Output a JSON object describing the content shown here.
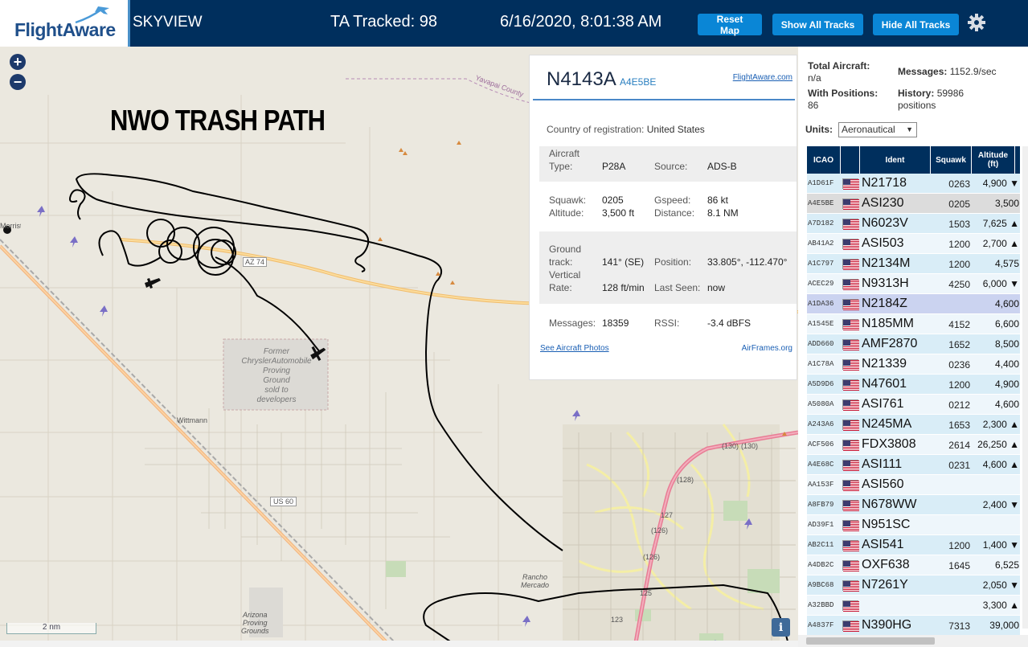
{
  "header": {
    "logo": "FlightAware",
    "app_title": "SKYVIEW",
    "ta_tracked": "TA Tracked: 98",
    "timestamp": "6/16/2020, 8:01:38 AM",
    "buttons": {
      "reset": "Reset Map",
      "show_all": "Show All Tracks",
      "hide_all": "Hide All Tracks"
    },
    "settings_icon": "gear-icon"
  },
  "map": {
    "zoom_in": "+",
    "zoom_out": "−",
    "annotation": "NWO TRASH PATH",
    "scale": "2 nm",
    "info": "i",
    "labels": {
      "former_site": [
        "Former",
        "ChryslerAutomobile",
        "Proving",
        "Ground",
        "sold to",
        "developers"
      ],
      "wittmann": "Wittmann",
      "us60": "US 60",
      "az74": "AZ 74",
      "rancho": [
        "Rancho",
        "Mercado"
      ],
      "arizona_pg": [
        "Arizona",
        "Proving",
        "Grounds"
      ],
      "town": "Morristown",
      "yavapai": "Yavapai County",
      "r127": "127",
      "r126a": "(126)",
      "r126b": "(126)",
      "r125": "125",
      "r123": "123",
      "r128": "(128)",
      "r130": "(130)",
      "r1301": "(130)"
    },
    "colors": {
      "track": "#000000",
      "road_primary": "#f6c27a",
      "road_major": "#e77f93",
      "railway": "#999999"
    }
  },
  "detail": {
    "callsign": "N4143A",
    "hex": "A4E5BE",
    "fa_link": "FlightAware.com",
    "country_label": "Country of registration:",
    "country": "United States",
    "aircraft_type_label": [
      "Aircraft",
      "Type:"
    ],
    "aircraft_type": "P28A",
    "source_label": "Source:",
    "source": "ADS-B",
    "squawk_label": "Squawk:",
    "squawk": "0205",
    "gspeed_label": "Gspeed:",
    "gspeed": "86 kt",
    "altitude_label": "Altitude:",
    "altitude": "3,500 ft",
    "distance_label": "Distance:",
    "distance": "8.1 NM",
    "track_label": [
      "Ground",
      "track:"
    ],
    "track": "141° (SE)",
    "position_label": "Position:",
    "position": "33.805°, -112.470°",
    "vrate_label": [
      "Vertical",
      "Rate:"
    ],
    "vrate": "128 ft/min",
    "last_seen_label": "Last Seen:",
    "last_seen": "now",
    "messages_label": "Messages:",
    "messages": "18359",
    "rssi_label": "RSSI:",
    "rssi": "-3.4 dBFS",
    "photos_link": "See Aircraft Photos",
    "airframes_link": "AirFrames.org"
  },
  "sidebar": {
    "total_aircraft_label": "Total Aircraft:",
    "total_aircraft": "n/a",
    "with_positions_label": "With Positions:",
    "with_positions": "86",
    "messages_label": "Messages:",
    "messages": "1152.9/sec",
    "history_label": "History:",
    "history": "59986",
    "history_unit": "positions",
    "units_label": "Units:",
    "units_value": "Aeronautical",
    "table": {
      "headers": {
        "icao": "ICAO",
        "ident": "Ident",
        "squawk": "Squawk",
        "altitude": [
          "Altitude",
          "(ft)"
        ]
      },
      "rows": [
        {
          "icao": "A1D61F",
          "ident": "N21718",
          "squawk": "0263",
          "alt": "4,900 ▼",
          "style": "alt"
        },
        {
          "icao": "A4E5BE",
          "ident": "ASI230",
          "squawk": "0205",
          "alt": "3,500",
          "style": "sel"
        },
        {
          "icao": "A7D182",
          "ident": "N6023V",
          "squawk": "1503",
          "alt": "7,625 ▲",
          "style": "alt"
        },
        {
          "icao": "AB41A2",
          "ident": "ASI503",
          "squawk": "1200",
          "alt": "2,700 ▲",
          "style": "plain"
        },
        {
          "icao": "A1C797",
          "ident": "N2134M",
          "squawk": "1200",
          "alt": "4,575",
          "style": "alt"
        },
        {
          "icao": "ACEC29",
          "ident": "N9313H",
          "squawk": "4250",
          "alt": "6,000 ▼",
          "style": "plain"
        },
        {
          "icao": "A1DA36",
          "ident": "N2184Z",
          "squawk": "",
          "alt": "4,600",
          "style": "hl"
        },
        {
          "icao": "A1545E",
          "ident": "N185MM",
          "squawk": "4152",
          "alt": "6,600",
          "style": "plain"
        },
        {
          "icao": "ADD660",
          "ident": "AMF2870",
          "squawk": "1652",
          "alt": "8,500",
          "style": "alt"
        },
        {
          "icao": "A1C78A",
          "ident": "N21339",
          "squawk": "0236",
          "alt": "4,400",
          "style": "plain"
        },
        {
          "icao": "A5D9D6",
          "ident": "N47601",
          "squawk": "1200",
          "alt": "4,900",
          "style": "alt"
        },
        {
          "icao": "A5080A",
          "ident": "ASI761",
          "squawk": "0212",
          "alt": "4,600",
          "style": "plain"
        },
        {
          "icao": "A243A6",
          "ident": "N245MA",
          "squawk": "1653",
          "alt": "2,300 ▲",
          "style": "alt"
        },
        {
          "icao": "ACF506",
          "ident": "FDX3808",
          "squawk": "2614",
          "alt": "26,250 ▲",
          "style": "plain"
        },
        {
          "icao": "A4E68C",
          "ident": "ASI111",
          "squawk": "0231",
          "alt": "4,600 ▲",
          "style": "alt"
        },
        {
          "icao": "AA153F",
          "ident": "ASI560",
          "squawk": "",
          "alt": "",
          "style": "plain"
        },
        {
          "icao": "A8FB79",
          "ident": "N678WW",
          "squawk": "",
          "alt": "2,400 ▼",
          "style": "alt"
        },
        {
          "icao": "AD39F1",
          "ident": "N951SC",
          "squawk": "",
          "alt": "",
          "style": "plain"
        },
        {
          "icao": "AB2C11",
          "ident": "ASI541",
          "squawk": "1200",
          "alt": "1,400 ▼",
          "style": "alt"
        },
        {
          "icao": "A4DB2C",
          "ident": "OXF638",
          "squawk": "1645",
          "alt": "6,525",
          "style": "plain"
        },
        {
          "icao": "A9BC68",
          "ident": "N7261Y",
          "squawk": "",
          "alt": "2,050 ▼",
          "style": "alt"
        },
        {
          "icao": "A32BBD",
          "ident": "",
          "squawk": "",
          "alt": "3,300 ▲",
          "style": "plain"
        },
        {
          "icao": "A4837F",
          "ident": "N390HG",
          "squawk": "7313",
          "alt": "39,000",
          "style": "alt"
        }
      ]
    }
  }
}
